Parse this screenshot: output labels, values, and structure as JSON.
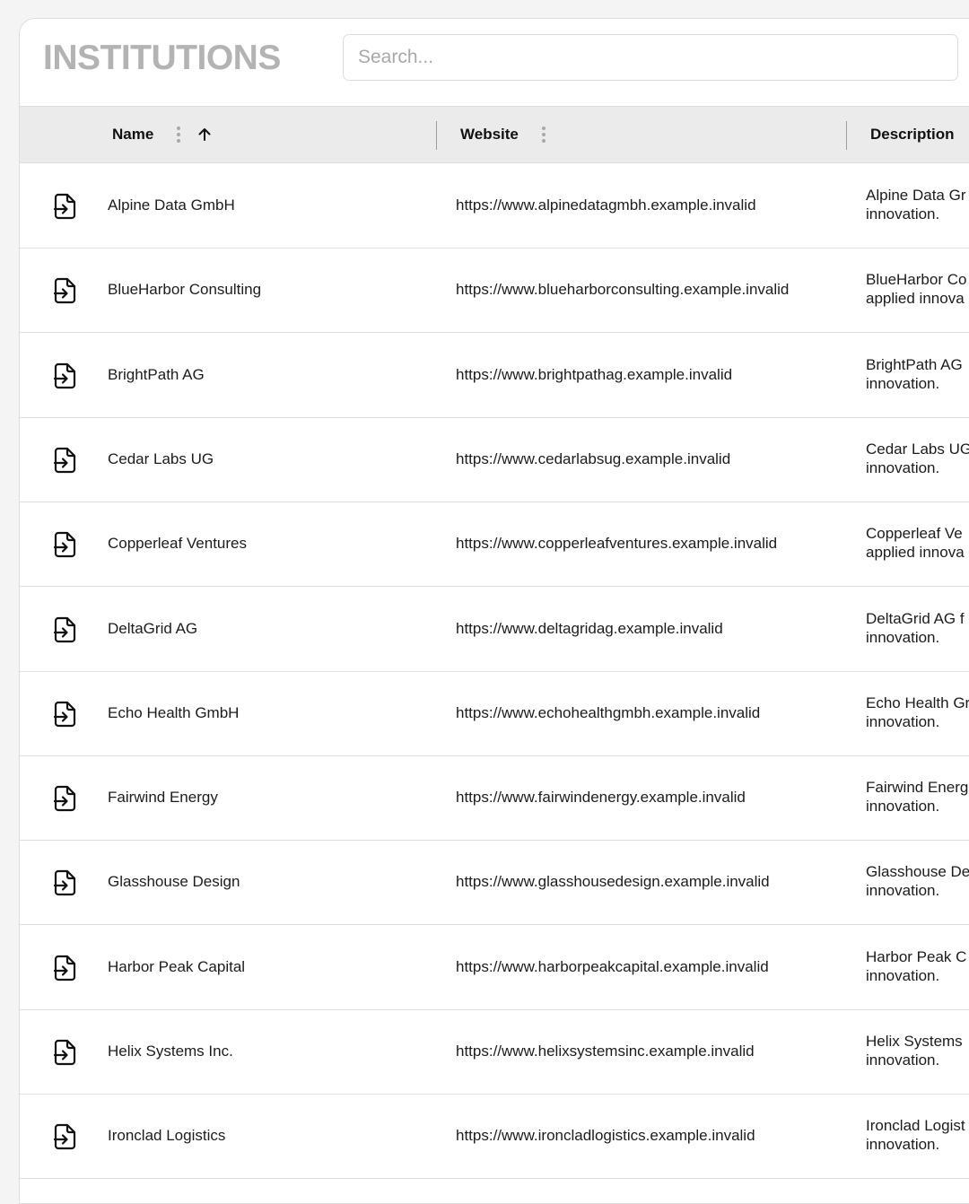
{
  "header": {
    "title": "INSTITUTIONS",
    "search_placeholder": "Search..."
  },
  "table": {
    "columns": {
      "name": "Name",
      "website": "Website",
      "description": "Description"
    },
    "sort": {
      "column": "Name",
      "direction": "ascending"
    },
    "rows": [
      {
        "name": "Alpine Data GmbH",
        "website": "https://www.alpinedatagmbh.example.invalid",
        "desc_line1": "Alpine Data Gr",
        "desc_line2": "innovation."
      },
      {
        "name": "BlueHarbor Consulting",
        "website": "https://www.blueharborconsulting.example.invalid",
        "desc_line1": "BlueHarbor Co",
        "desc_line2": "applied innova"
      },
      {
        "name": "BrightPath AG",
        "website": "https://www.brightpathag.example.invalid",
        "desc_line1": "BrightPath AG",
        "desc_line2": "innovation."
      },
      {
        "name": "Cedar Labs UG",
        "website": "https://www.cedarlabsug.example.invalid",
        "desc_line1": "Cedar Labs UG",
        "desc_line2": "innovation."
      },
      {
        "name": "Copperleaf Ventures",
        "website": "https://www.copperleafventures.example.invalid",
        "desc_line1": "Copperleaf Ve",
        "desc_line2": "applied innova"
      },
      {
        "name": "DeltaGrid AG",
        "website": "https://www.deltagridag.example.invalid",
        "desc_line1": "DeltaGrid AG f",
        "desc_line2": "innovation."
      },
      {
        "name": "Echo Health GmbH",
        "website": "https://www.echohealthgmbh.example.invalid",
        "desc_line1": "Echo Health Gr",
        "desc_line2": "innovation."
      },
      {
        "name": "Fairwind Energy",
        "website": "https://www.fairwindenergy.example.invalid",
        "desc_line1": "Fairwind Energ",
        "desc_line2": "innovation."
      },
      {
        "name": "Glasshouse Design",
        "website": "https://www.glasshousedesign.example.invalid",
        "desc_line1": "Glasshouse De",
        "desc_line2": "innovation."
      },
      {
        "name": "Harbor Peak Capital",
        "website": "https://www.harborpeakcapital.example.invalid",
        "desc_line1": "Harbor Peak C",
        "desc_line2": "innovation."
      },
      {
        "name": "Helix Systems Inc.",
        "website": "https://www.helixsystemsinc.example.invalid",
        "desc_line1": "Helix Systems",
        "desc_line2": "innovation."
      },
      {
        "name": "Ironclad Logistics",
        "website": "https://www.ironcladlogistics.example.invalid",
        "desc_line1": "Ironclad Logist",
        "desc_line2": "innovation."
      }
    ]
  },
  "icons": {
    "row_open": "file-arrow-right-icon",
    "column_menu": "kebab-menu-icon",
    "sort": "arrow-up-icon"
  },
  "colors": {
    "title": "#b3b3b3",
    "header_bg": "#ebebeb",
    "border": "#dedede",
    "placeholder": "#a9a9a9"
  }
}
